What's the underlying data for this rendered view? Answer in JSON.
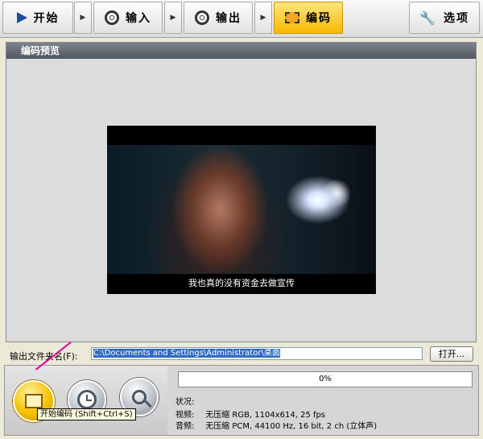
{
  "steps": [
    {
      "label": "开始",
      "icon": "play-icon"
    },
    {
      "label": "输入",
      "icon": "film-reel-icon"
    },
    {
      "label": "输出",
      "icon": "film-reel-icon"
    },
    {
      "label": "编码",
      "icon": "film-strip-icon",
      "active": true
    },
    {
      "label": "选项",
      "icon": "wrench-icon"
    }
  ],
  "step_arrow": "▶",
  "preview": {
    "title": "编码预览",
    "subtitle": "我也真的没有资金去做宣传"
  },
  "output_folder": {
    "label": "输出文件夹名(F):",
    "value": "C:\\Documents and Settings\\Administrator\\桌面",
    "open_button": "打开..."
  },
  "controls": {
    "tooltip": "开始编码 (Shift+Ctrl+S)"
  },
  "status": {
    "progress": "0%",
    "progress_fraction": 0,
    "state_label": "状况:",
    "video_label": "视频:",
    "video_value": "无压缩 RGB, 1104x614, 25 fps",
    "audio_label": "音频:",
    "audio_value": "无压缩 PCM, 44100 Hz, 16 bit, 2 ch (立体声)"
  },
  "colors": {
    "accent": "#f5b900",
    "panel_header": "#5d646e",
    "pointer": "#e000a0"
  }
}
